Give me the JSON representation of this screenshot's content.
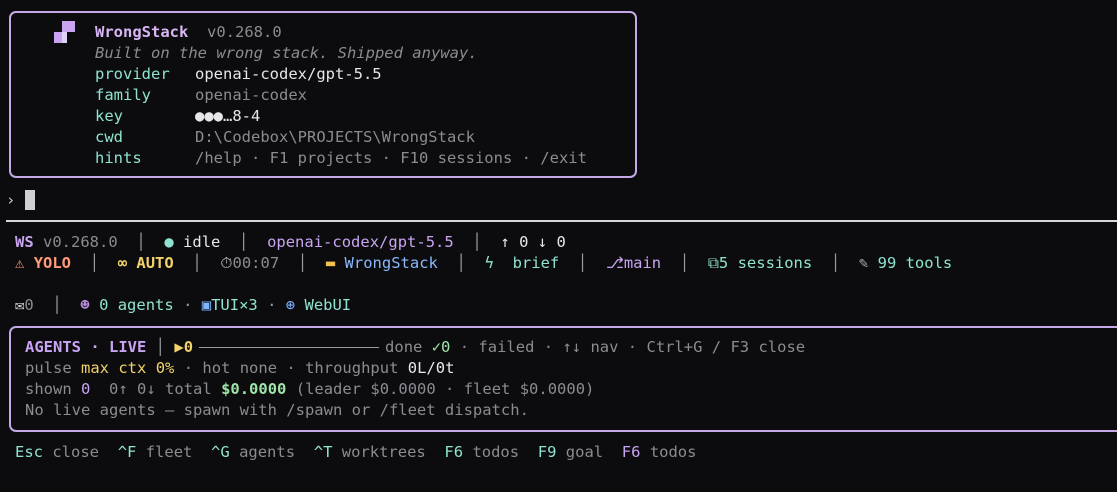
{
  "header": {
    "app_name": "WrongStack",
    "version": "v0.268.0",
    "tagline": "Built on the wrong stack. Shipped anyway.",
    "fields": [
      {
        "key": "provider",
        "value": "openai-codex/gpt-5.5"
      },
      {
        "key": "family",
        "value": "openai-codex"
      },
      {
        "key": "key",
        "value": "●●●…8-4"
      },
      {
        "key": "cwd",
        "value": "D:\\Codebox\\PROJECTS\\WrongStack"
      },
      {
        "key": "hints",
        "value": "/help · F1 projects · F10 sessions · /exit"
      }
    ]
  },
  "prompt": {
    "caret": "›"
  },
  "status": {
    "brand": "WS",
    "version": "v0.268.0",
    "state": "idle",
    "model": "openai-codex/gpt-5.5",
    "tokens_up": "0",
    "tokens_down": "0",
    "mode_yolo": "YOLO",
    "mode_auto": "AUTO",
    "timer": "00:07",
    "project": "WrongStack",
    "brief": "brief",
    "branch": "main",
    "sessions": "5 sessions",
    "tools": "99 tools",
    "mail_count": "0",
    "agents": "0 agents",
    "tui": "TUI×3",
    "webui": "WebUI"
  },
  "agents_panel": {
    "title": "AGENTS · LIVE",
    "running": "0",
    "done_label": "done",
    "done_count": "✓0",
    "failed_label": "failed",
    "nav_label": "↑↓ nav",
    "close_hint": "Ctrl+G / F3 close",
    "pulse_label": "pulse",
    "max_ctx_label": "max ctx",
    "max_ctx_value": "0%",
    "hot": "hot none",
    "throughput_label": "throughput",
    "throughput_value": "0L/0t",
    "shown_label": "shown",
    "shown_value": "0",
    "token_counts": "0↑ 0↓",
    "total_label": "total",
    "total_value": "$0.0000",
    "breakdown": "(leader $0.0000 · fleet $0.0000)",
    "empty_message": "No live agents — spawn with /spawn or /fleet dispatch."
  },
  "shortcuts": [
    {
      "key": "Esc",
      "label": "close"
    },
    {
      "key": "^F",
      "label": "fleet"
    },
    {
      "key": "^G",
      "label": "agents"
    },
    {
      "key": "^T",
      "label": "worktrees"
    },
    {
      "key": "F6",
      "label": "todos"
    },
    {
      "key": "F9",
      "label": "goal"
    },
    {
      "key": "F6",
      "label": "todos"
    }
  ],
  "colors": {
    "accent_border": "#c6a8e8",
    "teal": "#8fe3d0",
    "purple": "#c9a4f2",
    "background": "#0c0c0e"
  }
}
